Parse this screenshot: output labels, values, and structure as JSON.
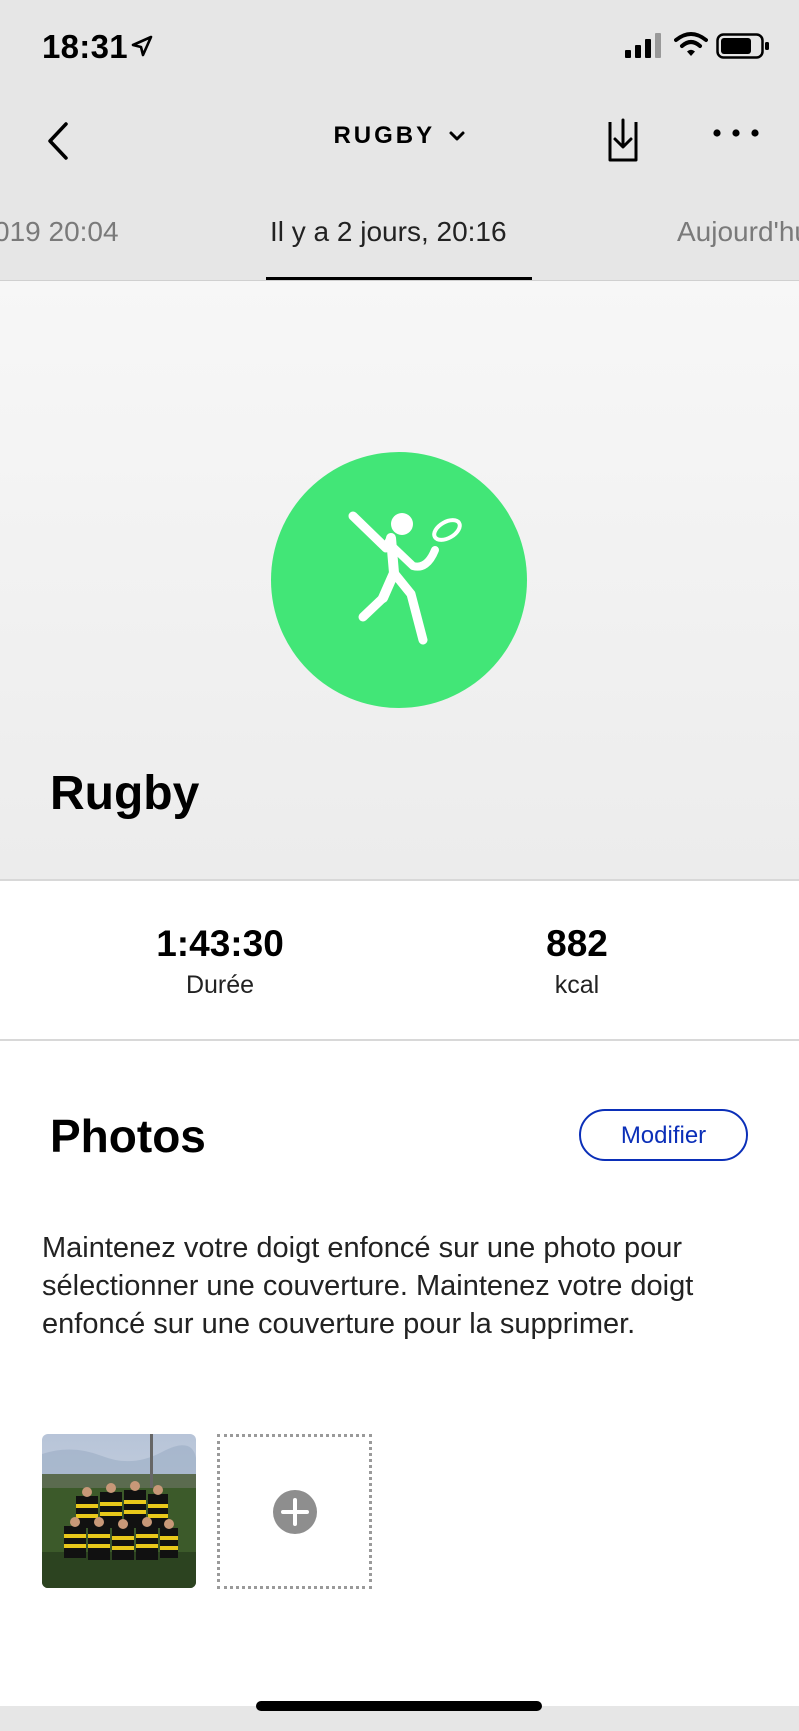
{
  "status_bar": {
    "time": "18:31",
    "icons": [
      "location-arrow-icon",
      "signal-icon",
      "wifi-icon",
      "battery-icon"
    ]
  },
  "nav": {
    "title": "RUGBY",
    "back_icon": "chevron-left-icon",
    "title_dropdown_icon": "chevron-down-icon",
    "download_icon": "download-icon",
    "more_icon": "more-icon"
  },
  "tabs": {
    "items": [
      {
        "label": "019 20:04",
        "active": false
      },
      {
        "label": "Il y a 2 jours, 20:16",
        "active": true
      },
      {
        "label": "Aujourd'hui",
        "active": false
      }
    ]
  },
  "activity": {
    "name": "Rugby",
    "icon": "rugby-player-icon",
    "color": "#42e677"
  },
  "stats": {
    "duration_value": "1:43:30",
    "duration_label": "Durée",
    "kcal_value": "882",
    "kcal_label": "kcal"
  },
  "photos": {
    "title": "Photos",
    "modify_label": "Modifier",
    "help_text": "Maintenez votre doigt enfoncé sur une photo pour sélectionner une couverture. Maintenez votre doigt enfoncé sur une couverture pour la supprimer.",
    "add_icon": "plus-circle-icon"
  },
  "colors": {
    "accent": "#0b2fb8",
    "activity": "#42e677",
    "header_bg": "#e6e6e6"
  }
}
